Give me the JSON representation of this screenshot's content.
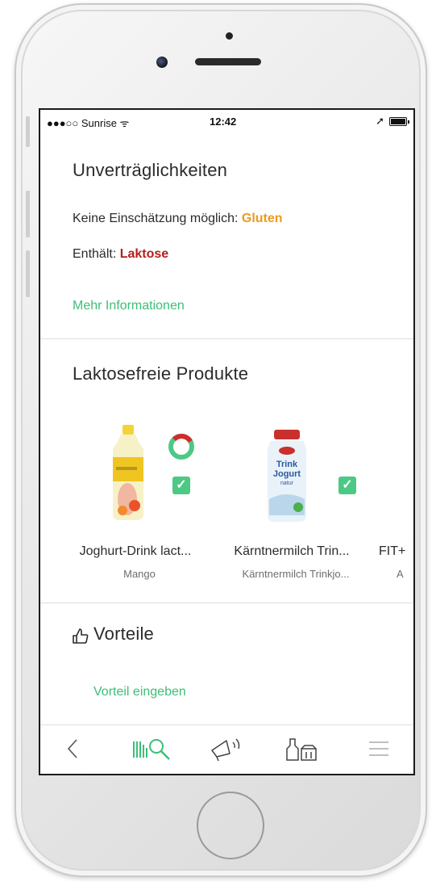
{
  "status_bar": {
    "carrier": "●●●○○ Sunrise ᯤ",
    "time": "12:42",
    "location_glyph": "➚"
  },
  "intolerances": {
    "title": "Unverträglichkeiten",
    "no_assessment_label": "Keine Einschätzung möglich:",
    "no_assessment_value": "Gluten",
    "contains_label": "Enthält:",
    "contains_value": "Laktose",
    "more_link": "Mehr Informationen"
  },
  "lactose_free": {
    "title": "Laktosefreie Produkte",
    "products": [
      {
        "name": "Joghurt-Drink lact...",
        "subtitle": "Mango",
        "checked": true
      },
      {
        "name": "Kärntnermilch Trin...",
        "subtitle": "Kärntnermilch Trinkjo...",
        "checked": true
      },
      {
        "name": "FIT+",
        "subtitle": "A"
      }
    ]
  },
  "advantages": {
    "title": "Vorteile",
    "enter_link": "Vorteil eingeben"
  },
  "tab_bar": {
    "items": [
      "back-icon",
      "barcode-scan-icon",
      "megaphone-icon",
      "products-icon",
      "menu-icon"
    ]
  },
  "colors": {
    "accent": "#3cbf77",
    "warning": "#ee9a1a",
    "danger": "#b41e1e",
    "check": "#4cc985"
  }
}
